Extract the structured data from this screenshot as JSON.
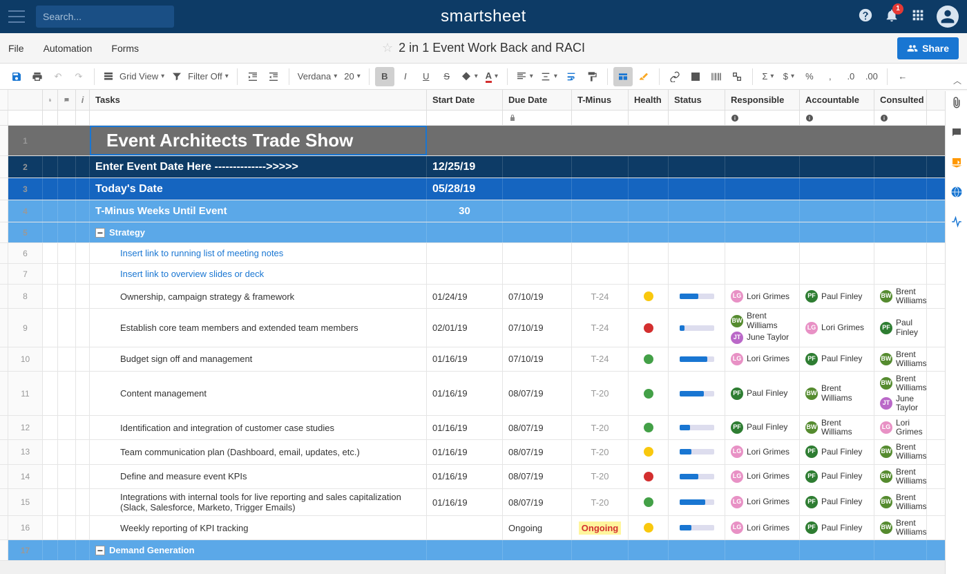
{
  "brand": "smartsheet",
  "search_placeholder": "Search...",
  "notif_count": "1",
  "menu": {
    "file": "File",
    "automation": "Automation",
    "forms": "Forms"
  },
  "title": "2 in 1 Event Work Back and RACI",
  "share": "Share",
  "toolbar": {
    "gridview": "Grid View",
    "filter": "Filter Off",
    "font": "Verdana",
    "size": "20"
  },
  "columns": {
    "tasks": "Tasks",
    "start": "Start Date",
    "due": "Due Date",
    "tminus": "T-Minus",
    "health": "Health",
    "status": "Status",
    "resp": "Responsible",
    "acc": "Accountable",
    "cons": "Consulted"
  },
  "rows": [
    {
      "num": "1",
      "task": "Event Architects Trade Show",
      "type": "title"
    },
    {
      "num": "2",
      "task": "Enter Event Date Here -------------->>>>>",
      "start": "12/25/19",
      "type": "dark"
    },
    {
      "num": "3",
      "task": "Today's Date",
      "start": "05/28/19",
      "type": "med"
    },
    {
      "num": "4",
      "task": "T-Minus Weeks Until Event",
      "start": "30",
      "center": true,
      "type": "light"
    },
    {
      "num": "5",
      "task": "Strategy",
      "type": "sect"
    },
    {
      "num": "6",
      "task": "Insert link to running list of meeting notes",
      "link": true,
      "indent": 2
    },
    {
      "num": "7",
      "task": "Insert link to overview slides or deck",
      "link": true,
      "indent": 2
    },
    {
      "num": "8",
      "task": "Ownership, campaign strategy & framework",
      "indent": 2,
      "start": "01/24/19",
      "due": "07/10/19",
      "tminus": "T-24",
      "health": "yellow",
      "status": 55,
      "resp": [
        {
          "n": "Lori Grimes",
          "c": "lg",
          "i": "LG"
        }
      ],
      "acc": [
        {
          "n": "Paul Finley",
          "c": "pf",
          "i": "PF"
        }
      ],
      "cons": [
        {
          "n": "Brent Williams",
          "c": "bw",
          "i": "BW"
        }
      ]
    },
    {
      "num": "9",
      "task": "Establish core team members and extended team members",
      "indent": 2,
      "start": "02/01/19",
      "due": "07/10/19",
      "tminus": "T-24",
      "health": "red",
      "status": 15,
      "resp": [
        {
          "n": "Brent Williams",
          "c": "bw",
          "i": "BW"
        },
        {
          "n": "June Taylor",
          "c": "jt",
          "i": "JT"
        }
      ],
      "acc": [
        {
          "n": "Lori Grimes",
          "c": "lg",
          "i": "LG"
        }
      ],
      "cons": [
        {
          "n": "Paul Finley",
          "c": "pf",
          "i": "PF"
        }
      ]
    },
    {
      "num": "10",
      "task": "Budget sign off and management",
      "indent": 2,
      "start": "01/16/19",
      "due": "07/10/19",
      "tminus": "T-24",
      "health": "green",
      "status": 80,
      "resp": [
        {
          "n": "Lori Grimes",
          "c": "lg",
          "i": "LG"
        }
      ],
      "acc": [
        {
          "n": "Paul Finley",
          "c": "pf",
          "i": "PF"
        }
      ],
      "cons": [
        {
          "n": "Brent Williams",
          "c": "bw",
          "i": "BW"
        }
      ]
    },
    {
      "num": "11",
      "task": "Content management",
      "indent": 2,
      "start": "01/16/19",
      "due": "08/07/19",
      "tminus": "T-20",
      "health": "green",
      "status": 70,
      "resp": [
        {
          "n": "Paul Finley",
          "c": "pf",
          "i": "PF"
        }
      ],
      "acc": [
        {
          "n": "Brent Williams",
          "c": "bw",
          "i": "BW"
        }
      ],
      "cons": [
        {
          "n": "Brent Williams",
          "c": "bw",
          "i": "BW"
        },
        {
          "n": "June Taylor",
          "c": "jt",
          "i": "JT"
        }
      ]
    },
    {
      "num": "12",
      "task": "Identification and integration of customer case studies",
      "indent": 2,
      "start": "01/16/19",
      "due": "08/07/19",
      "tminus": "T-20",
      "health": "green",
      "status": 30,
      "resp": [
        {
          "n": "Paul Finley",
          "c": "pf",
          "i": "PF"
        }
      ],
      "acc": [
        {
          "n": "Brent Williams",
          "c": "bw",
          "i": "BW"
        }
      ],
      "cons": [
        {
          "n": "Lori Grimes",
          "c": "lg",
          "i": "LG"
        }
      ]
    },
    {
      "num": "13",
      "task": "Team communication plan (Dashboard, email, updates, etc.)",
      "indent": 2,
      "start": "01/16/19",
      "due": "08/07/19",
      "tminus": "T-20",
      "health": "yellow",
      "status": 35,
      "resp": [
        {
          "n": "Lori Grimes",
          "c": "lg",
          "i": "LG"
        }
      ],
      "acc": [
        {
          "n": "Paul Finley",
          "c": "pf",
          "i": "PF"
        }
      ],
      "cons": [
        {
          "n": "Brent Williams",
          "c": "bw",
          "i": "BW"
        }
      ]
    },
    {
      "num": "14",
      "task": "Define and measure event KPIs",
      "indent": 2,
      "start": "01/16/19",
      "due": "08/07/19",
      "tminus": "T-20",
      "health": "red",
      "status": 55,
      "resp": [
        {
          "n": "Lori Grimes",
          "c": "lg",
          "i": "LG"
        }
      ],
      "acc": [
        {
          "n": "Paul Finley",
          "c": "pf",
          "i": "PF"
        }
      ],
      "cons": [
        {
          "n": "Brent Williams",
          "c": "bw",
          "i": "BW"
        }
      ]
    },
    {
      "num": "15",
      "task": "Integrations with internal tools for live reporting and sales capitalization (Slack, Salesforce, Marketo, Trigger Emails)",
      "indent": 2,
      "start": "01/16/19",
      "due": "08/07/19",
      "tminus": "T-20",
      "health": "green",
      "status": 75,
      "resp": [
        {
          "n": "Lori Grimes",
          "c": "lg",
          "i": "LG"
        }
      ],
      "acc": [
        {
          "n": "Paul Finley",
          "c": "pf",
          "i": "PF"
        }
      ],
      "cons": [
        {
          "n": "Brent Williams",
          "c": "bw",
          "i": "BW"
        }
      ]
    },
    {
      "num": "16",
      "task": "Weekly reporting of KPI tracking",
      "indent": 2,
      "due": "Ongoing",
      "tminus": "Ongoing",
      "tminus_hl": true,
      "health": "yellow",
      "status": 35,
      "resp": [
        {
          "n": "Lori Grimes",
          "c": "lg",
          "i": "LG"
        }
      ],
      "acc": [
        {
          "n": "Paul Finley",
          "c": "pf",
          "i": "PF"
        }
      ],
      "cons": [
        {
          "n": "Brent Williams",
          "c": "bw",
          "i": "BW"
        }
      ]
    },
    {
      "num": "17",
      "task": "Demand Generation",
      "type": "sect"
    }
  ]
}
